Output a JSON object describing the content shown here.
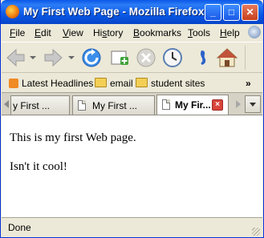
{
  "window": {
    "title": "My First Web Page - Mozilla Firefox"
  },
  "titlebar_buttons": {
    "minimize": "_",
    "maximize": "□",
    "close": "✕"
  },
  "menus": [
    {
      "underline": "F",
      "rest": "ile"
    },
    {
      "underline": "E",
      "rest": "dit"
    },
    {
      "underline": "V",
      "rest": "iew"
    },
    {
      "underline": "",
      "rest": "Hi",
      "underline2": "s",
      "rest2": "tory"
    },
    {
      "underline": "B",
      "rest": "ookmarks"
    },
    {
      "underline": "T",
      "rest": "ools"
    },
    {
      "underline": "H",
      "rest": "elp"
    }
  ],
  "bookmarks": {
    "latest_headlines": "Latest Headlines",
    "email": "email",
    "student_sites": "student sites",
    "overflow": "»"
  },
  "tabs": [
    {
      "label": "y First ..."
    },
    {
      "label": "My First ..."
    },
    {
      "label": "My Fir..."
    }
  ],
  "page": {
    "paragraph1": "This is my first Web page.",
    "paragraph2": "Isn't it cool!"
  },
  "status": {
    "text": "Done"
  },
  "colors": {
    "titlebar": "#0A5AE6",
    "close_button": "#C6401E",
    "window_bg": "#ECE9D8"
  }
}
